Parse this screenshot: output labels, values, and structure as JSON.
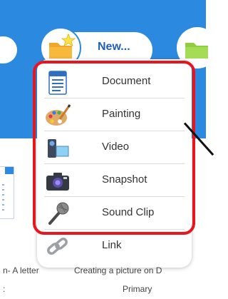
{
  "toolbar": {
    "new_label": "New..."
  },
  "menu": {
    "items": [
      {
        "label": "Document",
        "icon": "document-icon"
      },
      {
        "label": "Painting",
        "icon": "palette-icon"
      },
      {
        "label": "Video",
        "icon": "video-camera-icon"
      },
      {
        "label": "Snapshot",
        "icon": "camera-icon"
      },
      {
        "label": "Sound Clip",
        "icon": "microphone-icon"
      },
      {
        "label": "Link",
        "icon": "link-icon"
      }
    ]
  },
  "gallery": {
    "caption_left": "n- A letter",
    "caption_middle_line1": "Creating a picture on D",
    "caption_middle_line2": "Primary",
    "caption_left_line2": ":"
  },
  "colors": {
    "toolbar_blue": "#2b8ae0",
    "highlight_red": "#e8151f",
    "new_label": "#1f5fb8"
  }
}
